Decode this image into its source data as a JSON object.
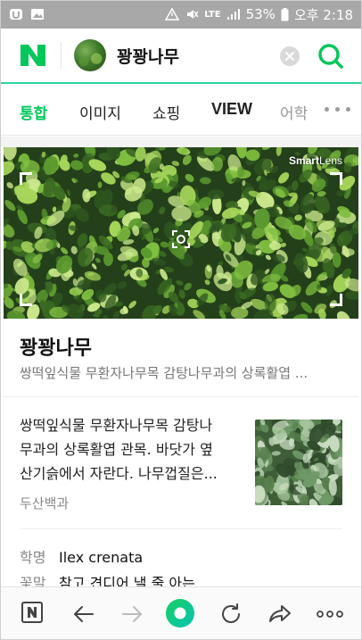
{
  "status_bar": {
    "battery_percent": "53%",
    "network": "LTE",
    "time": "오후 2:18"
  },
  "search": {
    "query": "꽝꽝나무",
    "accent_color": "#03c75a",
    "icons": [
      "naver-n-icon",
      "clear-icon",
      "search-icon"
    ]
  },
  "tabs": [
    {
      "label": "통합",
      "active": true
    },
    {
      "label": "이미지",
      "active": false
    },
    {
      "label": "쇼핑",
      "active": false
    },
    {
      "label": "VIEW",
      "active": false
    },
    {
      "label": "어학",
      "active": false
    }
  ],
  "lens": {
    "brand_bold": "Smart",
    "brand_thin": "Lens"
  },
  "result": {
    "title": "꽝꽝나무",
    "subtitle": "쌍떡잎식물 무환자나무목 감탕나무과의 상록활엽 ...",
    "description_lines": [
      "쌍떡잎식물 무환자나무목 감탕나",
      "무과의 상록활엽 관목. 바닷가 옆",
      "산기슭에서 자란다. 나무껍질은..."
    ],
    "source": "두산백과",
    "info": [
      {
        "key": "학명",
        "value": "Ilex crenata"
      },
      {
        "key": "꽃말",
        "value": "참고 견디어 낼 줄 아는"
      }
    ]
  },
  "bottom_bar": {
    "buttons": [
      "naver-home",
      "back",
      "forward",
      "green-dot",
      "refresh",
      "share",
      "more"
    ]
  }
}
